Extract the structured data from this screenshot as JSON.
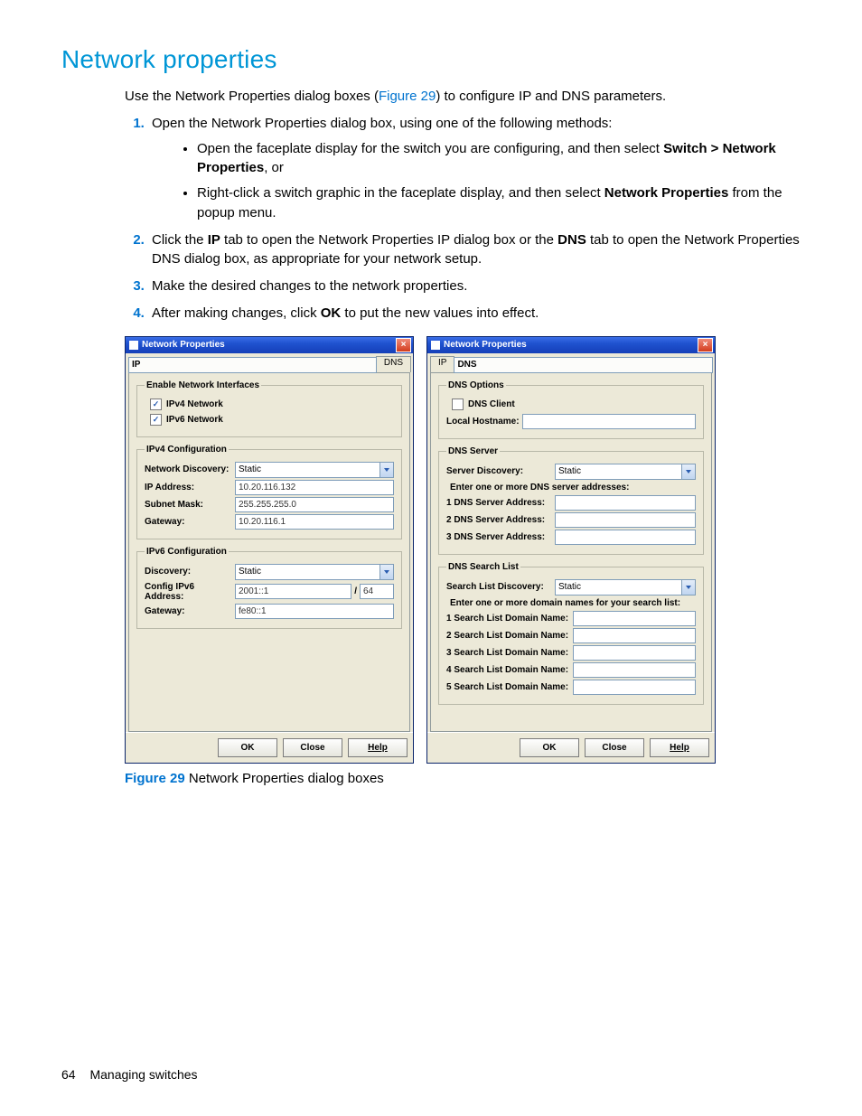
{
  "heading": "Network properties",
  "intro_pre": "Use the Network Properties dialog boxes (",
  "intro_link": "Figure 29",
  "intro_post": ") to configure IP and DNS parameters.",
  "steps": {
    "s1": "Open the Network Properties dialog box, using one of the following methods:",
    "s1a_pre": "Open the faceplate display for the switch you are configuring, and then select ",
    "s1a_bold": "Switch > Network Properties",
    "s1a_post": ", or",
    "s1b_pre": "Right-click a switch graphic in the faceplate display, and then select ",
    "s1b_bold": "Network Properties",
    "s1b_post": " from the popup menu.",
    "s2_pre": "Click the ",
    "s2_ip": "IP",
    "s2_mid": " tab to open the Network Properties IP dialog box or the ",
    "s2_dns": "DNS",
    "s2_post": " tab to open the Network Properties DNS dialog box, as appropriate for your network setup.",
    "s3": "Make the desired changes to the network properties.",
    "s4_pre": "After making changes, click ",
    "s4_ok": "OK",
    "s4_post": " to put the new values into effect."
  },
  "dlg_left": {
    "title": "Network Properties",
    "tab_ip": "IP",
    "tab_dns": "DNS",
    "grp_enable": "Enable Network Interfaces",
    "ck_ipv4": "IPv4 Network",
    "ck_ipv6": "IPv6 Network",
    "grp_v4": "IPv4 Configuration",
    "lab_netdisc": "Network Discovery:",
    "val_static": "Static",
    "lab_ip": "IP Address:",
    "val_ip": "10.20.116.132",
    "lab_mask": "Subnet Mask:",
    "val_mask": "255.255.255.0",
    "lab_gw": "Gateway:",
    "val_gw": "10.20.116.1",
    "grp_v6": "IPv6 Configuration",
    "lab_disc": "Discovery:",
    "lab_cfg6": "Config IPv6 Address:",
    "val_cfg6": "2001::1",
    "val_prefix": "64",
    "lab_gw6": "Gateway:",
    "val_gw6": "fe80::1",
    "btn_ok": "OK",
    "btn_close": "Close",
    "btn_help": "Help"
  },
  "dlg_right": {
    "title": "Network Properties",
    "tab_ip": "IP",
    "tab_dns": "DNS",
    "grp_opts": "DNS Options",
    "ck_client": "DNS Client",
    "lab_host": "Local Hostname:",
    "grp_srv": "DNS Server",
    "lab_sdisc": "Server Discovery:",
    "val_static": "Static",
    "hint_srv": "Enter one or more DNS server addresses:",
    "lab_s1": "1 DNS Server Address:",
    "lab_s2": "2 DNS Server Address:",
    "lab_s3": "3 DNS Server Address:",
    "grp_search": "DNS Search List",
    "lab_sldisc": "Search List Discovery:",
    "hint_search": "Enter one or more domain names for your search list:",
    "lab_d1": "1 Search List Domain Name:",
    "lab_d2": "2 Search List Domain Name:",
    "lab_d3": "3 Search List Domain Name:",
    "lab_d4": "4 Search List Domain Name:",
    "lab_d5": "5 Search List Domain Name:",
    "btn_ok": "OK",
    "btn_close": "Close",
    "btn_help": "Help"
  },
  "caption_fig": "Figure 29",
  "caption_text": " Network Properties dialog boxes",
  "footer_page": "64",
  "footer_section": "Managing switches"
}
